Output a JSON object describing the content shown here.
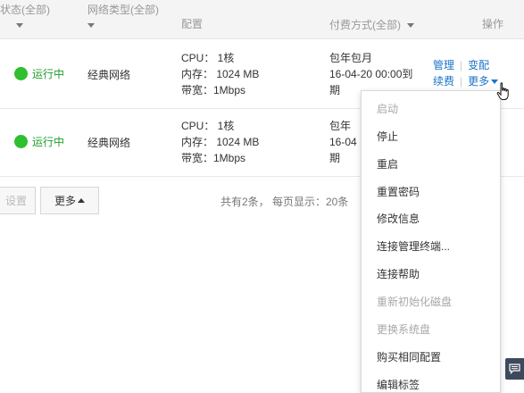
{
  "header": {
    "status_col": "状态(全部)",
    "network_col": "网络类型(全部)",
    "config_col": "配置",
    "payment_col": "付费方式(全部)",
    "ops_col": "操作"
  },
  "rows": [
    {
      "status": "运行中",
      "network": "经典网络",
      "cpu": "CPU： 1核",
      "memory": "内存： 1024 MB",
      "bandwidth": "带宽：1Mbps",
      "pay_type": "包年包月",
      "pay_date": "16-04-20 00:00到",
      "pay_tail": "期",
      "op_manage": "管理",
      "op_change": "变配",
      "op_renew": "续费",
      "op_more": "更多"
    },
    {
      "status": "运行中",
      "network": "经典网络",
      "cpu": "CPU： 1核",
      "memory": "内存： 1024 MB",
      "bandwidth": "带宽：1Mbps",
      "pay_type": "包年",
      "pay_date": "16-04",
      "pay_tail": "期"
    }
  ],
  "footer": {
    "settings_label": "设置",
    "more_label": "更多",
    "page_info": "共有2条， 每页显示：20条"
  },
  "menu": {
    "items": [
      {
        "label": "启动",
        "disabled": true
      },
      {
        "label": "停止",
        "disabled": false
      },
      {
        "label": "重启",
        "disabled": false
      },
      {
        "label": "重置密码",
        "disabled": false
      },
      {
        "label": "修改信息",
        "disabled": false
      },
      {
        "label": "连接管理终端...",
        "disabled": false
      },
      {
        "label": "连接帮助",
        "disabled": false
      },
      {
        "label": "重新初始化磁盘",
        "disabled": true
      },
      {
        "label": "更换系统盘",
        "disabled": true
      },
      {
        "label": "购买相同配置",
        "disabled": false
      },
      {
        "label": "编辑标签",
        "disabled": false
      }
    ]
  },
  "colors": {
    "running_green": "#2fbf2f",
    "link_blue": "#1a74c7",
    "disabled_gray": "#a8a8a8"
  }
}
